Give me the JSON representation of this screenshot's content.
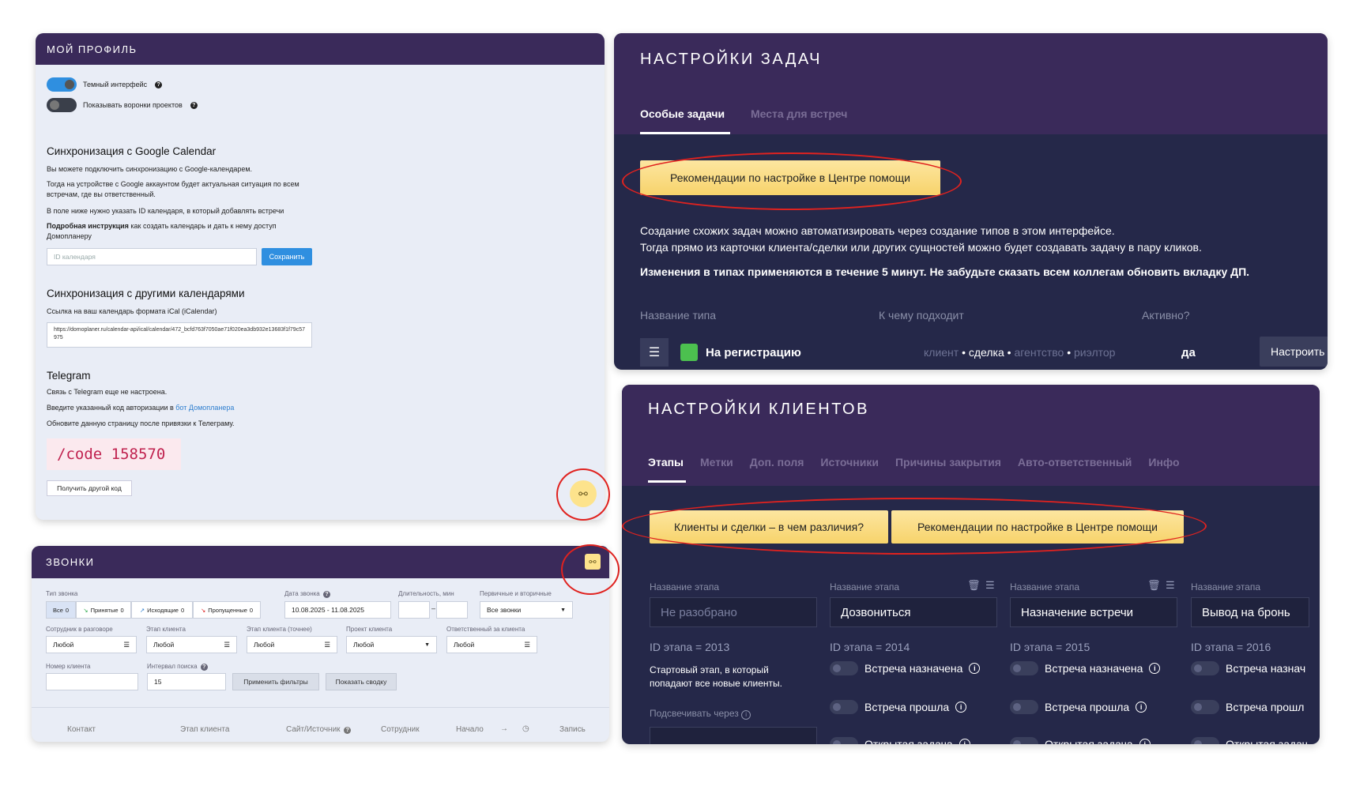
{
  "profile": {
    "title": "МОЙ ПРОФИЛЬ",
    "toggle_dark": "Темный интерфейс",
    "toggle_funnels": "Показывать воронки проектов",
    "google": {
      "heading": "Синхронизация с Google Calendar",
      "line1": "Вы можете подключить синхронизацию с Google-календарем.",
      "line2": "Тогда на устройстве с Google аккаунтом будет актуальная ситуация по всем встречам, где вы ответственный.",
      "line3": "В поле ниже нужно указать ID календаря, в который добавлять встречи",
      "instr_bold": "Подробная инструкция",
      "instr_rest": " как создать календарь и дать к нему доступ Домопланеру",
      "input_placeholder": "ID календаря",
      "save_label": "Сохранить"
    },
    "other": {
      "heading": "Синхронизация с другими календарями",
      "line1": "Ссылка на ваш календарь формата iCal (iCalendar)",
      "url": "https://domoplaner.ru/calendar-api/ical/calendar/472_bcfd763f7050ae71f020ea3db932e13683f1f79c57975"
    },
    "telegram": {
      "heading": "Telegram",
      "line1": "Связь с Telegram еще не настроена.",
      "line2_a": "Введите указанный код авторизации в ",
      "line2_link": "бот Домопланера",
      "line3": "Обновите данную страницу после привязки к Телеграму.",
      "code": "/code 158570",
      "new_code_label": "Получить другой код"
    }
  },
  "calls": {
    "title": "ЗВОНКИ",
    "type_label": "Тип звонка",
    "types": [
      {
        "label": "Все",
        "count": "0"
      },
      {
        "label": "Принятые",
        "count": "0"
      },
      {
        "label": "Исходящие",
        "count": "0"
      },
      {
        "label": "Пропущенные",
        "count": "0"
      }
    ],
    "date_label": "Дата звонка",
    "date_value": "10.08.2025 - 11.08.2025",
    "duration_label": "Длительность, мин",
    "primary_label": "Первичные и вторичные",
    "primary_value": "Все звонки",
    "employee_label": "Сотрудник в разговоре",
    "stage_label": "Этап клиента",
    "stage_exact_label": "Этап клиента (точнее)",
    "project_label": "Проект клиента",
    "responsible_label": "Ответственный за клиента",
    "any": "Любой",
    "phone_label": "Номер клиента",
    "interval_label": "Интервал поиска",
    "interval_value": "15",
    "apply_label": "Применить фильтры",
    "summary_label": "Показать сводку",
    "columns": [
      "Контакт",
      "Этап клиента",
      "Сайт/Источник",
      "Сотрудник",
      "Начало",
      "Запись"
    ]
  },
  "tasks": {
    "title": "НАСТРОЙКИ ЗАДАЧ",
    "tabs": [
      "Особые задачи",
      "Места для встреч"
    ],
    "help_button": "Рекомендации по настройке в Центре помощи",
    "desc1": "Создание схожих задач можно автоматизировать через создание типов в этом интерфейсе.",
    "desc2": "Тогда прямо из карточки клиента/сделки или других сущностей можно будет создавать задачу в пару кликов.",
    "warning": "Изменения в типах применяются в течение 5 минут. Не забудьте сказать всем коллегам обновить вкладку ДП.",
    "col_name": "Название типа",
    "col_fits": "К чему подходит",
    "col_active": "Активно?",
    "row": {
      "name": "На регистрацию",
      "fits": [
        {
          "label": "клиент",
          "on": false
        },
        {
          "label": "сделка",
          "on": true
        },
        {
          "label": "агентство",
          "on": false
        },
        {
          "label": "риэлтор",
          "on": false
        }
      ],
      "active": "да",
      "configure": "Настроить",
      "color": "#4cc04f"
    }
  },
  "clients": {
    "title": "НАСТРОЙКИ КЛИЕНТОВ",
    "tabs": [
      "Этапы",
      "Метки",
      "Доп. поля",
      "Источники",
      "Причины закрытия",
      "Авто-ответственный",
      "Инфо"
    ],
    "btn_diff": "Клиенты и сделки – в чем различия?",
    "btn_help": "Рекомендации по настройке в Центре помощи",
    "stage_label": "Название этапа",
    "stages": [
      {
        "name": "Не разобрано",
        "id": "ID этапа = 2013"
      },
      {
        "name": "Дозвониться",
        "id": "ID этапа = 2014"
      },
      {
        "name": "Назначение встречи",
        "id": "ID этапа = 2015"
      },
      {
        "name": "Вывод на бронь",
        "id": "ID этапа = 2016"
      }
    ],
    "start_desc": "Стартовый этап, в который попадают все новые клиенты.",
    "highlight": "Подсвечивать через",
    "t_meet_set": "Встреча назначена",
    "t_meet_done": "Встреча прошла",
    "t_open_task": "Открытая задача",
    "t_meet_set_cut": "Встреча назнач",
    "t_meet_done_cut": "Встреча прошл",
    "t_open_task_cut": "Открытая задач"
  }
}
